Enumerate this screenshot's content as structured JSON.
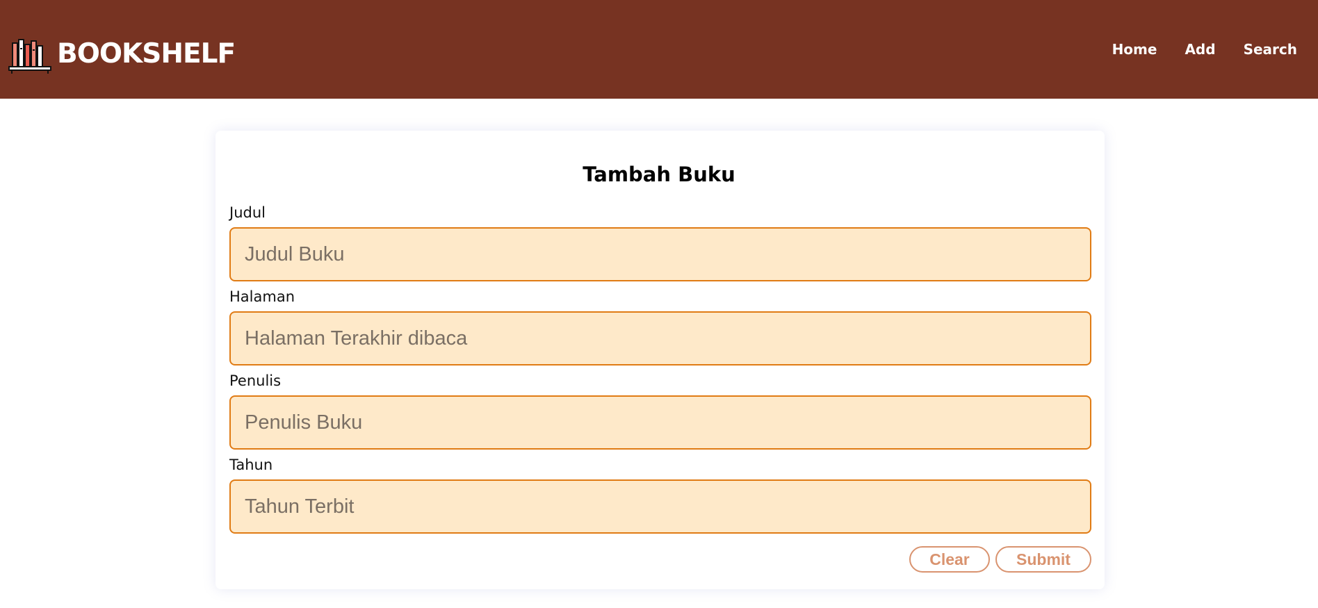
{
  "header": {
    "brand_title": "BOOKSHELF",
    "logo_icon": "bookshelf-icon",
    "background_color": "#773322",
    "nav": [
      {
        "label": "Home"
      },
      {
        "label": "Add"
      },
      {
        "label": "Search"
      }
    ]
  },
  "form": {
    "title": "Tambah Buku",
    "fields": [
      {
        "label": "Judul",
        "placeholder": "Judul Buku",
        "value": ""
      },
      {
        "label": "Halaman",
        "placeholder": "Halaman Terakhir dibaca",
        "value": ""
      },
      {
        "label": "Penulis",
        "placeholder": "Penulis Buku",
        "value": ""
      },
      {
        "label": "Tahun",
        "placeholder": "Tahun Terbit",
        "value": ""
      }
    ],
    "input_background": "#fee9c9",
    "input_border": "#e07b14",
    "clear_label": "Clear",
    "submit_label": "Submit",
    "button_color": "#d9936f"
  }
}
